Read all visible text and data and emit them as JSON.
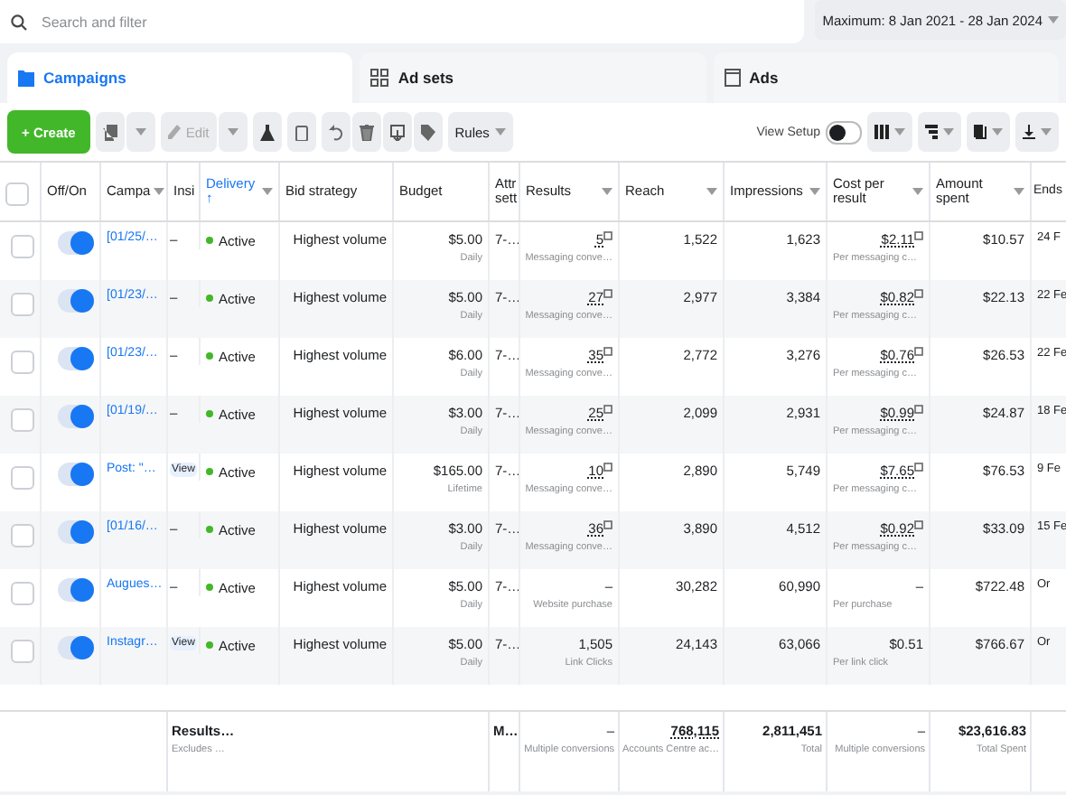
{
  "search": {
    "placeholder": "Search and filter"
  },
  "date_range": "Maximum: 8 Jan 2021 - 28 Jan 2024",
  "tabs": [
    {
      "label": "Campaigns",
      "selected": true,
      "kind": "campaigns"
    },
    {
      "label": "Ad sets",
      "selected": false,
      "kind": "adsets"
    },
    {
      "label": "Ads",
      "selected": false,
      "kind": "ads"
    }
  ],
  "toolbar": {
    "create": "+ Create",
    "edit": "Edit",
    "edit_disabled": true,
    "rules": "Rules",
    "view_setup": "View Setup",
    "view_setup_on": false
  },
  "columns": [
    {
      "kind": "check"
    },
    {
      "label": "Off/On",
      "kind": "text",
      "sorted": false
    },
    {
      "label": "Campa",
      "kind": "text",
      "menu": true,
      "sorted": false
    },
    {
      "label": "Insi",
      "kind": "text",
      "sorted": false
    },
    {
      "label": "Delivery",
      "sort_indicator": "↑",
      "kind": "text",
      "menu": true,
      "sorted": true
    },
    {
      "label": "Bid strategy",
      "kind": "text",
      "sorted": false
    },
    {
      "label": "Budget",
      "kind": "text",
      "sorted": false
    },
    {
      "label": "Attr sett",
      "kind": "text",
      "sorted": false
    },
    {
      "label": "Results",
      "kind": "text",
      "menu": true,
      "sorted": false
    },
    {
      "label": "Reach",
      "kind": "text",
      "menu": true,
      "sorted": false
    },
    {
      "label": "Impressions",
      "kind": "text",
      "menu": true,
      "sorted": false
    },
    {
      "label": "Cost per result",
      "kind": "text",
      "menu": true,
      "sorted": false
    },
    {
      "label": "Amount spent",
      "kind": "text",
      "menu": true,
      "sorted": false
    },
    {
      "label": "Ends",
      "kind": "text",
      "sorted": false
    }
  ],
  "header_checked": false,
  "rows": [
    {
      "checked": false,
      "on": true,
      "campaign": "[01/25/…",
      "insights": {
        "kind": "dash",
        "text": "–"
      },
      "delivery": "Active",
      "bid": "Highest volume",
      "budget": "$5.00",
      "budget_period": "Daily",
      "attribution": "7-…",
      "results": "5",
      "results_label": "Messaging conve…",
      "results_info": true,
      "reach": "1,522",
      "impressions": "1,623",
      "cost": "$2.11",
      "cost_label": "Per messaging c…",
      "cost_info": true,
      "spent": "$10.57",
      "ends": "24 F"
    },
    {
      "checked": false,
      "on": true,
      "campaign": "[01/23/…",
      "insights": {
        "kind": "dash",
        "text": "–"
      },
      "delivery": "Active",
      "bid": "Highest volume",
      "budget": "$5.00",
      "budget_period": "Daily",
      "attribution": "7-…",
      "results": "27",
      "results_label": "Messaging conve…",
      "results_info": true,
      "reach": "2,977",
      "impressions": "3,384",
      "cost": "$0.82",
      "cost_label": "Per messaging c…",
      "cost_info": true,
      "spent": "$22.13",
      "ends": "22 Fe"
    },
    {
      "checked": false,
      "on": true,
      "campaign": "[01/23/…",
      "insights": {
        "kind": "dash",
        "text": "–"
      },
      "delivery": "Active",
      "bid": "Highest volume",
      "budget": "$6.00",
      "budget_period": "Daily",
      "attribution": "7-…",
      "results": "35",
      "results_label": "Messaging conve…",
      "results_info": true,
      "reach": "2,772",
      "impressions": "3,276",
      "cost": "$0.76",
      "cost_label": "Per messaging c…",
      "cost_info": true,
      "spent": "$26.53",
      "ends": "22 Fe"
    },
    {
      "checked": false,
      "on": true,
      "campaign": "[01/19/…",
      "insights": {
        "kind": "dash",
        "text": "–"
      },
      "delivery": "Active",
      "bid": "Highest volume",
      "budget": "$3.00",
      "budget_period": "Daily",
      "attribution": "7-…",
      "results": "25",
      "results_label": "Messaging conve…",
      "results_info": true,
      "reach": "2,099",
      "impressions": "2,931",
      "cost": "$0.99",
      "cost_label": "Per messaging c…",
      "cost_info": true,
      "spent": "$24.87",
      "ends": "18 Fe"
    },
    {
      "checked": false,
      "on": true,
      "campaign": "Post: \"…",
      "insights": {
        "kind": "view",
        "text": "View"
      },
      "delivery": "Active",
      "bid": "Highest volume",
      "budget": "$165.00",
      "budget_period": "Lifetime",
      "attribution": "7-…",
      "results": "10",
      "results_label": "Messaging conve…",
      "results_info": true,
      "reach": "2,890",
      "impressions": "5,749",
      "cost": "$7.65",
      "cost_label": "Per messaging c…",
      "cost_info": true,
      "spent": "$76.53",
      "ends": "9 Fe"
    },
    {
      "checked": false,
      "on": true,
      "campaign": "[01/16/…",
      "insights": {
        "kind": "dash",
        "text": "–"
      },
      "delivery": "Active",
      "bid": "Highest volume",
      "budget": "$3.00",
      "budget_period": "Daily",
      "attribution": "7-…",
      "results": "36",
      "results_label": "Messaging conve…",
      "results_info": true,
      "reach": "3,890",
      "impressions": "4,512",
      "cost": "$0.92",
      "cost_label": "Per messaging c…",
      "cost_info": true,
      "spent": "$33.09",
      "ends": "15 Fe"
    },
    {
      "checked": false,
      "on": true,
      "campaign": "Augues…",
      "insights": {
        "kind": "dash",
        "text": "–"
      },
      "delivery": "Active",
      "bid": "Highest volume",
      "budget": "$5.00",
      "budget_period": "Daily",
      "attribution": "7-…",
      "results": "–",
      "results_label": "Website purchase",
      "results_info": false,
      "reach": "30,282",
      "impressions": "60,990",
      "cost": "–",
      "cost_label": "Per purchase",
      "cost_info": false,
      "spent": "$722.48",
      "ends": "Or"
    },
    {
      "checked": false,
      "on": true,
      "campaign": "Instagr…",
      "insights": {
        "kind": "view",
        "text": "View"
      },
      "delivery": "Active",
      "bid": "Highest volume",
      "budget": "$5.00",
      "budget_period": "Daily",
      "attribution": "7-…",
      "results": "1,505",
      "results_label": "Link Clicks",
      "results_info": false,
      "reach": "24,143",
      "impressions": "63,066",
      "cost": "$0.51",
      "cost_label": "Per link click",
      "cost_info": false,
      "spent": "$766.67",
      "ends": "Or"
    }
  ],
  "footer": {
    "title": "Results…",
    "subtitle": "Excludes …",
    "attribution": "M…",
    "results": "–",
    "results_label": "Multiple conversions",
    "reach": "768,115",
    "reach_label": "Accounts Centre ac…",
    "impressions": "2,811,451",
    "impressions_label": "Total",
    "cost": "–",
    "cost_label": "Multiple conversions",
    "spent": "$23,616.83",
    "spent_label": "Total Spent"
  }
}
